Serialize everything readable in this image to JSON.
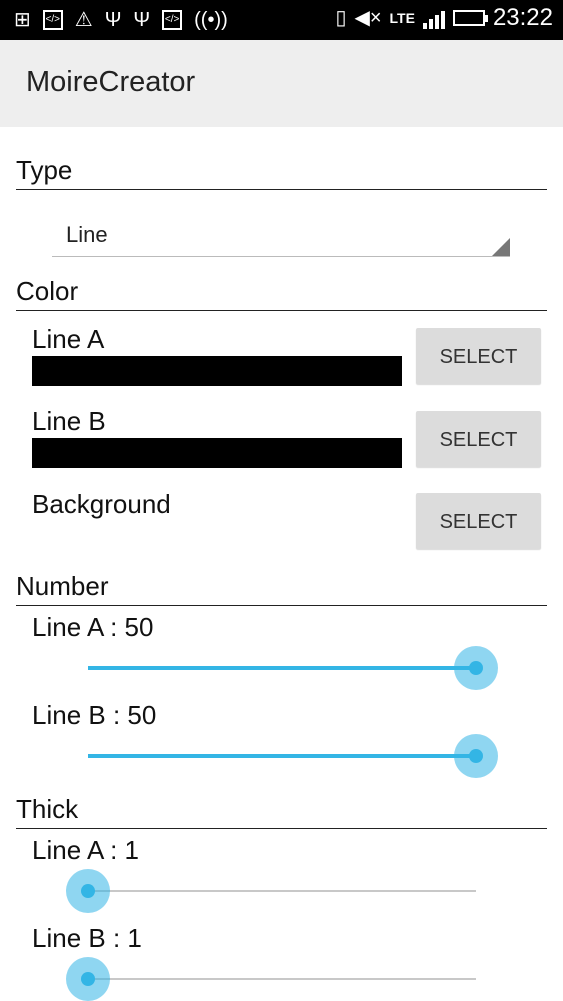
{
  "status_bar": {
    "time": "23:22",
    "network": "LTE",
    "icons": [
      "notification-add-icon",
      "code-icon",
      "warning-icon",
      "usb-icon",
      "usb-icon",
      "code-icon",
      "hotspot-icon",
      "phone-icon",
      "mute-icon",
      "signal-icon",
      "battery-charging-icon"
    ]
  },
  "app": {
    "title": "MoireCreator"
  },
  "sections": {
    "type": "Type",
    "color": "Color",
    "number": "Number",
    "thick": "Thick"
  },
  "type_spinner": {
    "value": "Line"
  },
  "colors": [
    {
      "label": "Line A",
      "button": "SELECT",
      "swatch": "#000000"
    },
    {
      "label": "Line B",
      "button": "SELECT",
      "swatch": "#000000"
    },
    {
      "label": "Background",
      "button": "SELECT"
    }
  ],
  "number": [
    {
      "label": "Line A : 50",
      "value": 50,
      "max": 50
    },
    {
      "label": "Line B : 50",
      "value": 50,
      "max": 50
    }
  ],
  "thick": [
    {
      "label": "Line A : 1",
      "value": 1,
      "min": 1,
      "max": 50
    },
    {
      "label": "Line B : 1",
      "value": 1,
      "min": 1,
      "max": 50
    }
  ],
  "accent_color": "#33b5e5"
}
